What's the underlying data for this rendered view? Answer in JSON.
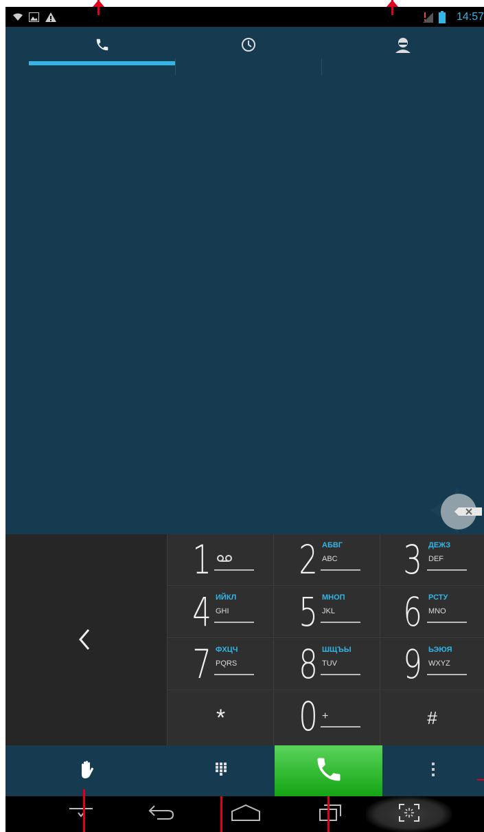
{
  "status_bar": {
    "time": "14:57",
    "icons": [
      "wifi-icon",
      "image-icon",
      "warning-icon",
      "no-sim-icon",
      "signal-icon",
      "battery-icon"
    ]
  },
  "tabs": [
    {
      "name": "dialer",
      "icon": "phone-icon",
      "selected": true
    },
    {
      "name": "call-log",
      "icon": "clock-icon",
      "selected": false
    },
    {
      "name": "contacts",
      "icon": "person-icon",
      "selected": false
    }
  ],
  "dialpad": {
    "keys": [
      {
        "digit": "1",
        "cyr": "",
        "lat": "ഠഠ"
      },
      {
        "digit": "2",
        "cyr": "АБВГ",
        "lat": "ABC"
      },
      {
        "digit": "3",
        "cyr": "ДЕЖЗ",
        "lat": "DEF"
      },
      {
        "digit": "4",
        "cyr": "ИЙКЛ",
        "lat": "GHI"
      },
      {
        "digit": "5",
        "cyr": "МНОП",
        "lat": "JKL"
      },
      {
        "digit": "6",
        "cyr": "РСТУ",
        "lat": "MNO"
      },
      {
        "digit": "7",
        "cyr": "ФХЦЧ",
        "lat": "PQRS"
      },
      {
        "digit": "8",
        "cyr": "ШЩЪЫ",
        "lat": "TUV"
      },
      {
        "digit": "9",
        "cyr": "ЬЭЮЯ",
        "lat": "WXYZ"
      },
      {
        "digit": "*",
        "cyr": "",
        "lat": ""
      },
      {
        "digit": "0",
        "cyr": "",
        "lat": "+"
      },
      {
        "digit": "#",
        "cyr": "",
        "lat": ""
      }
    ]
  },
  "actions": [
    "hand-icon",
    "dialpad-icon",
    "call-icon",
    "overflow-menu-icon"
  ],
  "nav": [
    "hide-keyboard-icon",
    "back-icon",
    "home-icon",
    "recent-apps-icon",
    "screenshot-icon"
  ],
  "colors": {
    "accent": "#33b5e5",
    "call": "#1eaa1e",
    "background": "#163a4f"
  }
}
